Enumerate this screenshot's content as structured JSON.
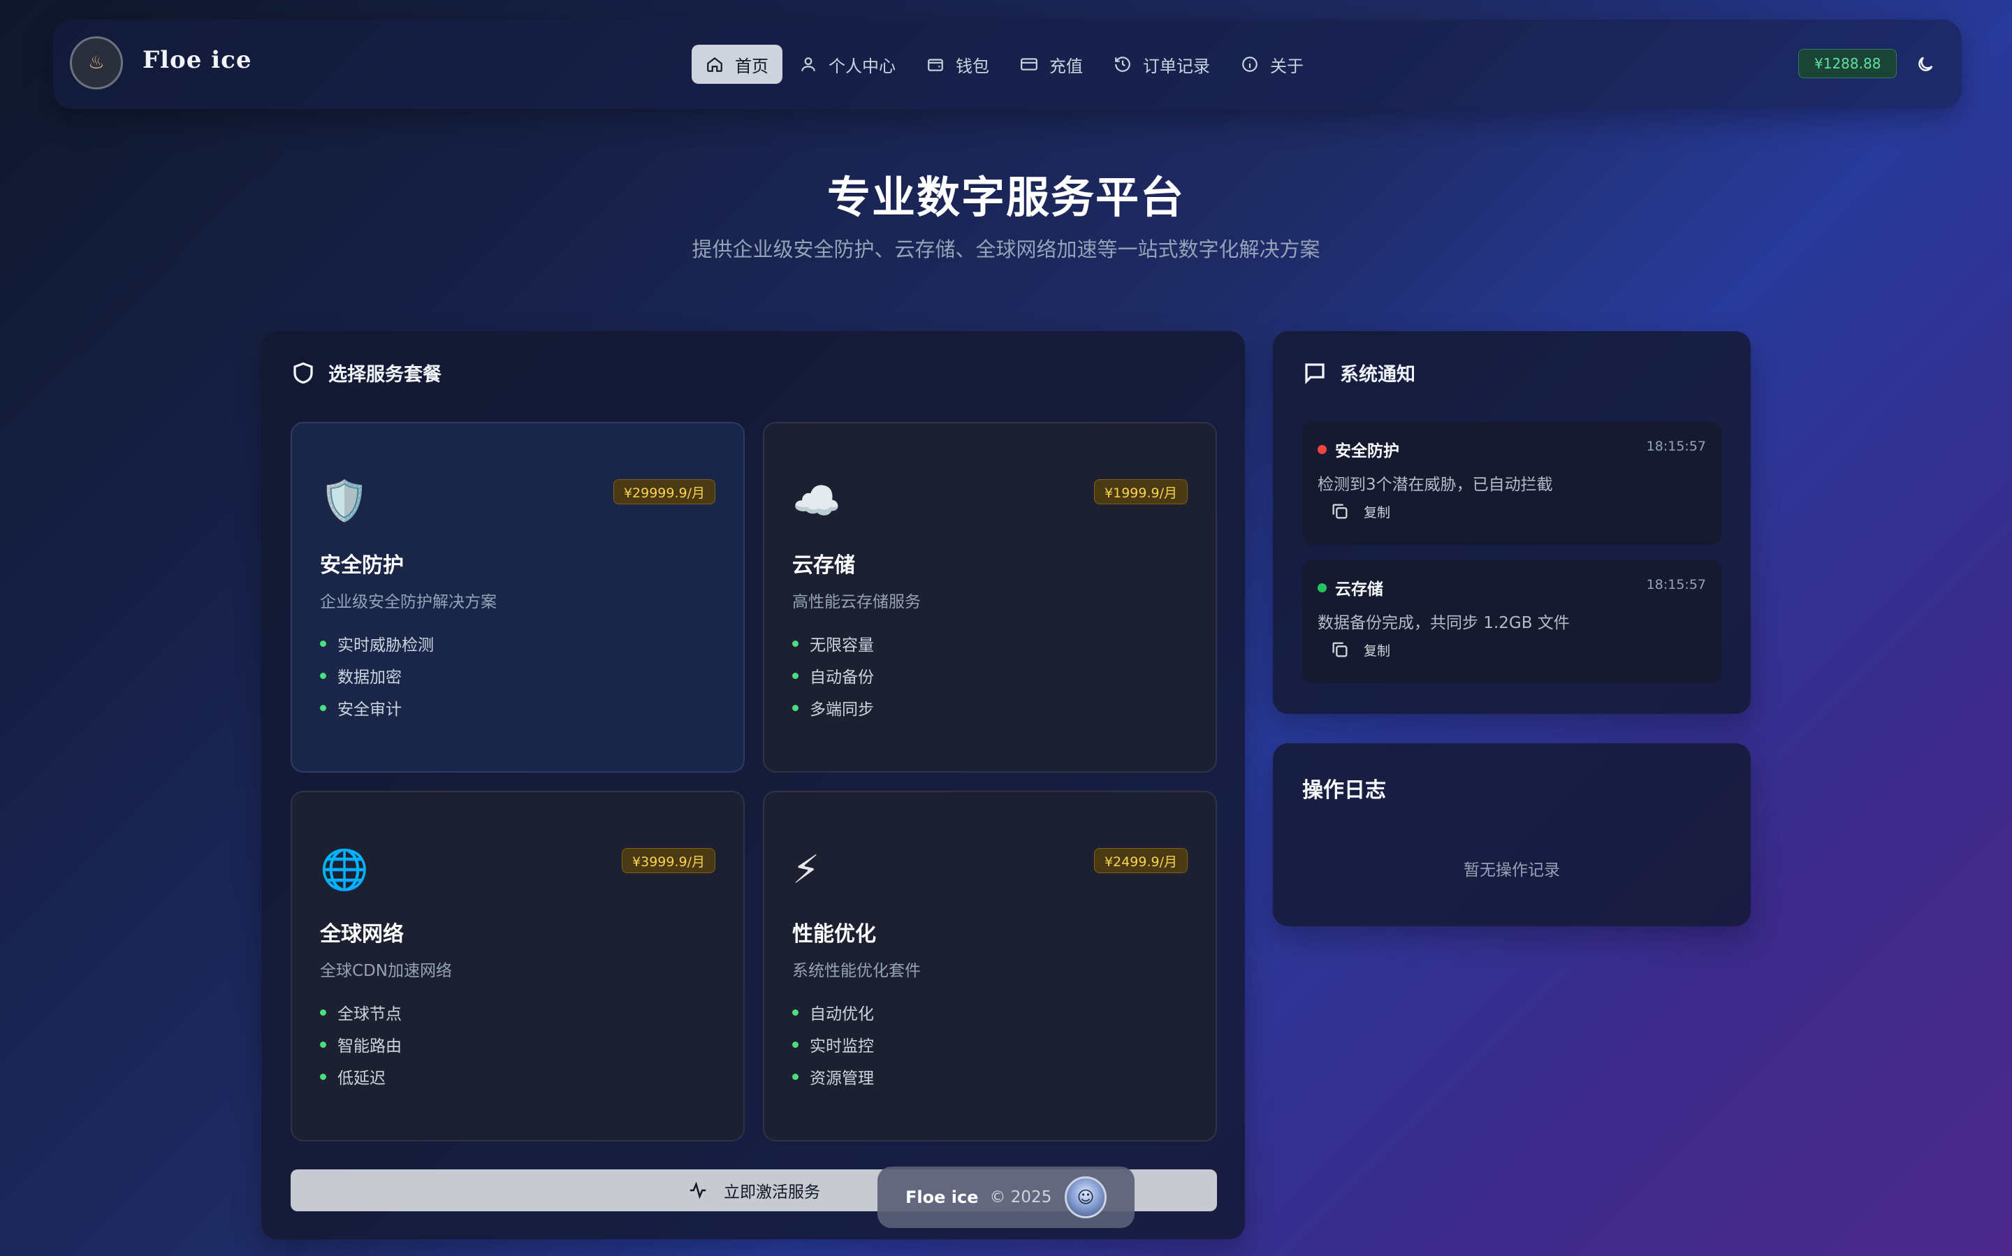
{
  "brand": {
    "name": "Floe ice",
    "logo_icon": "flame-emblem-icon"
  },
  "nav": {
    "items": [
      {
        "label": "首页",
        "icon": "home-icon",
        "active": true
      },
      {
        "label": "个人中心",
        "icon": "user-icon",
        "active": false
      },
      {
        "label": "钱包",
        "icon": "wallet-icon",
        "active": false
      },
      {
        "label": "充值",
        "icon": "credit-card-icon",
        "active": false
      },
      {
        "label": "订单记录",
        "icon": "history-icon",
        "active": false
      },
      {
        "label": "关于",
        "icon": "info-icon",
        "active": false
      }
    ]
  },
  "header": {
    "balance": "¥1288.88",
    "theme_icon": "moon-icon"
  },
  "hero": {
    "title": "专业数字服务平台",
    "subtitle": "提供企业级安全防护、云存储、全球网络加速等一站式数字化解决方案"
  },
  "services": {
    "heading": "选择服务套餐",
    "cards": [
      {
        "emoji": "🛡️",
        "title": "安全防护",
        "desc": "企业级安全防护解决方案",
        "price": "¥29999.9/月",
        "features": [
          "实时威胁检测",
          "数据加密",
          "安全审计"
        ]
      },
      {
        "emoji": "☁️",
        "title": "云存储",
        "desc": "高性能云存储服务",
        "price": "¥1999.9/月",
        "features": [
          "无限容量",
          "自动备份",
          "多端同步"
        ]
      },
      {
        "emoji": "🌐",
        "title": "全球网络",
        "desc": "全球CDN加速网络",
        "price": "¥3999.9/月",
        "features": [
          "全球节点",
          "智能路由",
          "低延迟"
        ]
      },
      {
        "emoji": "⚡",
        "title": "性能优化",
        "desc": "系统性能优化套件",
        "price": "¥2499.9/月",
        "features": [
          "自动优化",
          "实时监控",
          "资源管理"
        ]
      }
    ],
    "activate_label": "立即激活服务"
  },
  "notifications": {
    "heading": "系统通知",
    "items": [
      {
        "title": "安全防护",
        "time": "18:15:57",
        "text": "检测到3个潜在威胁，已自动拦截",
        "copy": "复制",
        "dot_color": "#ef4444"
      },
      {
        "title": "云存储",
        "time": "18:15:57",
        "text": "数据备份完成，共同步 1.2GB 文件",
        "copy": "复制",
        "dot_color": "#22c55e"
      }
    ]
  },
  "log": {
    "heading": "操作日志",
    "empty": "暂无操作记录"
  },
  "footer": {
    "brand": "Floe ice",
    "copyright": "© 2025"
  }
}
